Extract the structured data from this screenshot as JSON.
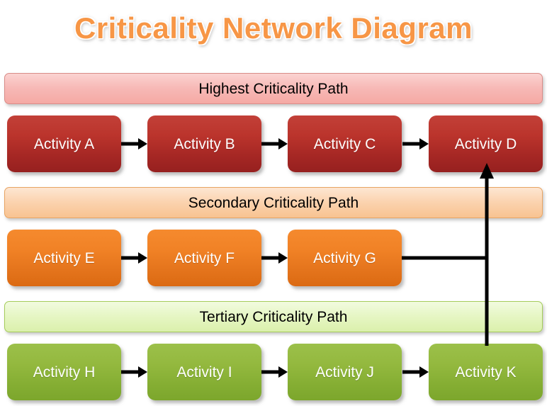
{
  "title": "Criticality Network Diagram",
  "colors": {
    "title_text": "#F79646",
    "band_red": "#F5A9A4",
    "band_orange": "#F8C391",
    "band_green": "#DBF0AC",
    "node_red": "#A52724",
    "node_orange": "#E4741C",
    "node_green": "#85AE33",
    "connector": "#000000",
    "background": "#FFFFFF"
  },
  "bands": [
    {
      "label": "Highest Criticality Path"
    },
    {
      "label": "Secondary Criticality Path"
    },
    {
      "label": "Tertiary Criticality Path"
    }
  ],
  "rows": [
    {
      "band_label": "Highest Criticality Path",
      "nodes": [
        {
          "label": "Activity A"
        },
        {
          "label": "Activity B"
        },
        {
          "label": "Activity C"
        },
        {
          "label": "Activity D"
        }
      ]
    },
    {
      "band_label": "Secondary Criticality Path",
      "nodes": [
        {
          "label": "Activity E"
        },
        {
          "label": "Activity F"
        },
        {
          "label": "Activity G"
        }
      ]
    },
    {
      "band_label": "Tertiary Criticality Path",
      "nodes": [
        {
          "label": "Activity H"
        },
        {
          "label": "Activity I"
        },
        {
          "label": "Activity J"
        },
        {
          "label": "Activity K"
        }
      ]
    }
  ],
  "connectors": {
    "arrow_a_b": "Activity A to Activity B",
    "arrow_b_c": "Activity B to Activity C",
    "arrow_c_d": "Activity C to Activity D",
    "arrow_e_f": "Activity E to Activity F",
    "arrow_f_g": "Activity F to Activity G",
    "arrow_h_i": "Activity H to Activity I",
    "arrow_i_j": "Activity I to Activity J",
    "arrow_j_k": "Activity J to Activity K",
    "arrow_g_d": "Activity G to Activity D",
    "arrow_k_d": "Activity K to Activity D"
  }
}
